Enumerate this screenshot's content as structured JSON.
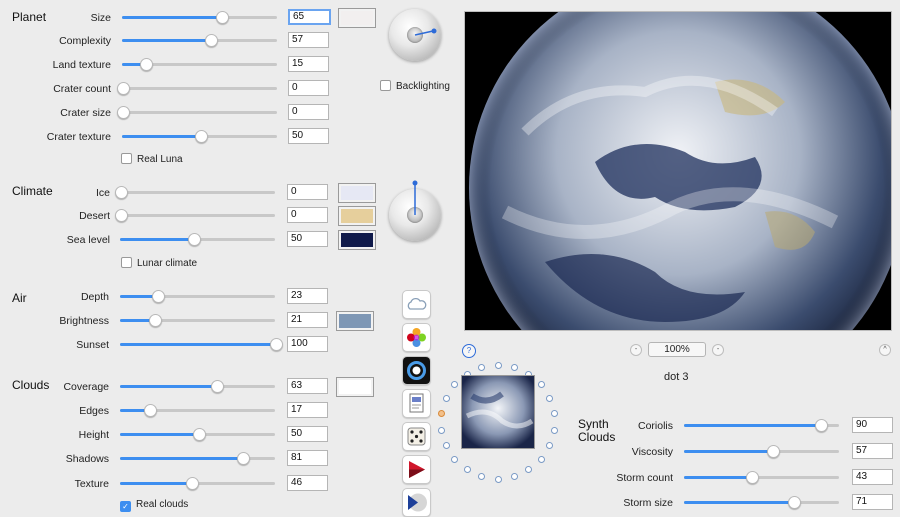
{
  "planet": {
    "title": "Planet",
    "rows": [
      {
        "label": "Size",
        "value": "65",
        "pct": 0.64
      },
      {
        "label": "Complexity",
        "value": "57",
        "pct": 0.57
      },
      {
        "label": "Land texture",
        "value": "15",
        "pct": 0.15
      },
      {
        "label": "Crater count",
        "value": "0",
        "pct": 0.0
      },
      {
        "label": "Crater size",
        "value": "0",
        "pct": 0.0
      },
      {
        "label": "Crater texture",
        "value": "50",
        "pct": 0.5
      }
    ],
    "size_color": "#f2efef",
    "real_luna": "Real Luna",
    "backlighting": "Backlighting"
  },
  "climate": {
    "title": "Climate",
    "rows": [
      {
        "label": "Ice",
        "value": "0",
        "pct": 0.0
      },
      {
        "label": "Desert",
        "value": "0",
        "pct": 0.0
      },
      {
        "label": "Sea level",
        "value": "50",
        "pct": 0.47
      }
    ],
    "ice_color": "#e6e8f4",
    "desert_color": "#e6cf9c",
    "sea_color": "#101a4a",
    "lunar_climate": "Lunar climate"
  },
  "air": {
    "title": "Air",
    "rows": [
      {
        "label": "Depth",
        "value": "23",
        "pct": 0.24
      },
      {
        "label": "Brightness",
        "value": "21",
        "pct": 0.22
      },
      {
        "label": "Sunset",
        "value": "100",
        "pct": 1.0
      }
    ],
    "brightness_color": "#7e97b5"
  },
  "clouds": {
    "title": "Clouds",
    "rows": [
      {
        "label": "Coverage",
        "value": "63",
        "pct": 0.62
      },
      {
        "label": "Edges",
        "value": "17",
        "pct": 0.19
      },
      {
        "label": "Height",
        "value": "50",
        "pct": 0.5
      },
      {
        "label": "Shadows",
        "value": "81",
        "pct": 0.79
      },
      {
        "label": "Texture",
        "value": "46",
        "pct": 0.46
      }
    ],
    "coverage_color": "#ffffff",
    "real_clouds": "Real clouds"
  },
  "synth": {
    "title_line1": "Synth",
    "title_line2": "Clouds",
    "rows": [
      {
        "label": "Coriolis",
        "value": "90",
        "pct": 0.88
      },
      {
        "label": "Viscosity",
        "value": "57",
        "pct": 0.57
      },
      {
        "label": "Storm count",
        "value": "43",
        "pct": 0.43
      },
      {
        "label": "Storm size",
        "value": "71",
        "pct": 0.7
      }
    ]
  },
  "preview": {
    "zoom": "100%",
    "minus": "-",
    "plus": "+",
    "help": "?",
    "caret": "^",
    "dot_label": "dot 3"
  },
  "tools": [
    "cloud-icon",
    "flower-icon",
    "ring-icon",
    "document-icon",
    "dice-icon",
    "red-arrow-icon",
    "play-disc-icon"
  ]
}
